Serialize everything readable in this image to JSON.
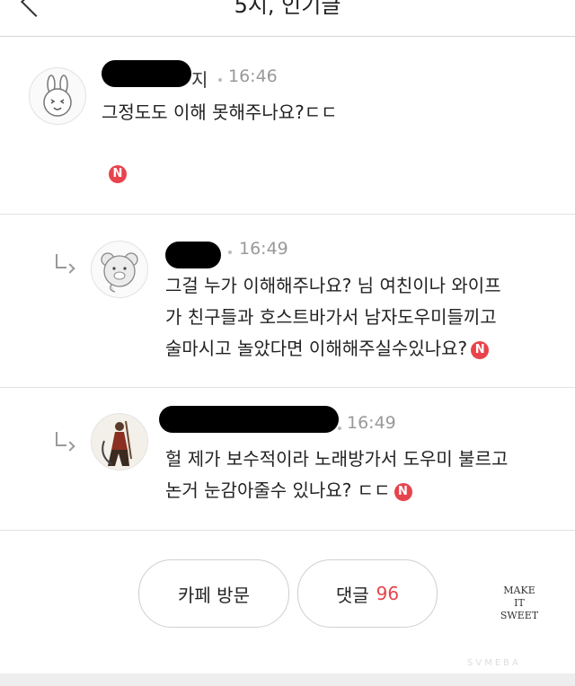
{
  "header": {
    "title": "5시, 인기글"
  },
  "comments": [
    {
      "name_suffix": "지",
      "time": "16:46",
      "lines": [
        "그정도도 이해 못해주나요?ㄷㄷ"
      ],
      "badge": "N"
    },
    {
      "name_suffix": "",
      "time": "16:49",
      "lines": [
        "그걸 누가 이해해주나요? 님 여친이나 와이프",
        "가 친구들과 호스트바가서 남자도우미들끼고",
        "술마시고 놀았다면 이해해주실수있나요?"
      ],
      "badge": "N"
    },
    {
      "name_suffix": "",
      "time": "16:49",
      "lines": [
        "헐 제가 보수적이라 노래방가서 도우미 불르고",
        "논거 눈감아줄수 있나요? ㄷㄷ"
      ],
      "badge": "N"
    }
  ],
  "buttons": {
    "cafe_visit": "카페 방문",
    "comments_label": "댓글",
    "comments_count": "96"
  },
  "watermark": {
    "line1": "MAKE",
    "line2": "IT",
    "line3": "SWEET",
    "sub": "SVMEBA"
  },
  "colors": {
    "accent": "#e8434c",
    "separator": "#e3e3e3",
    "muted": "#999999"
  }
}
